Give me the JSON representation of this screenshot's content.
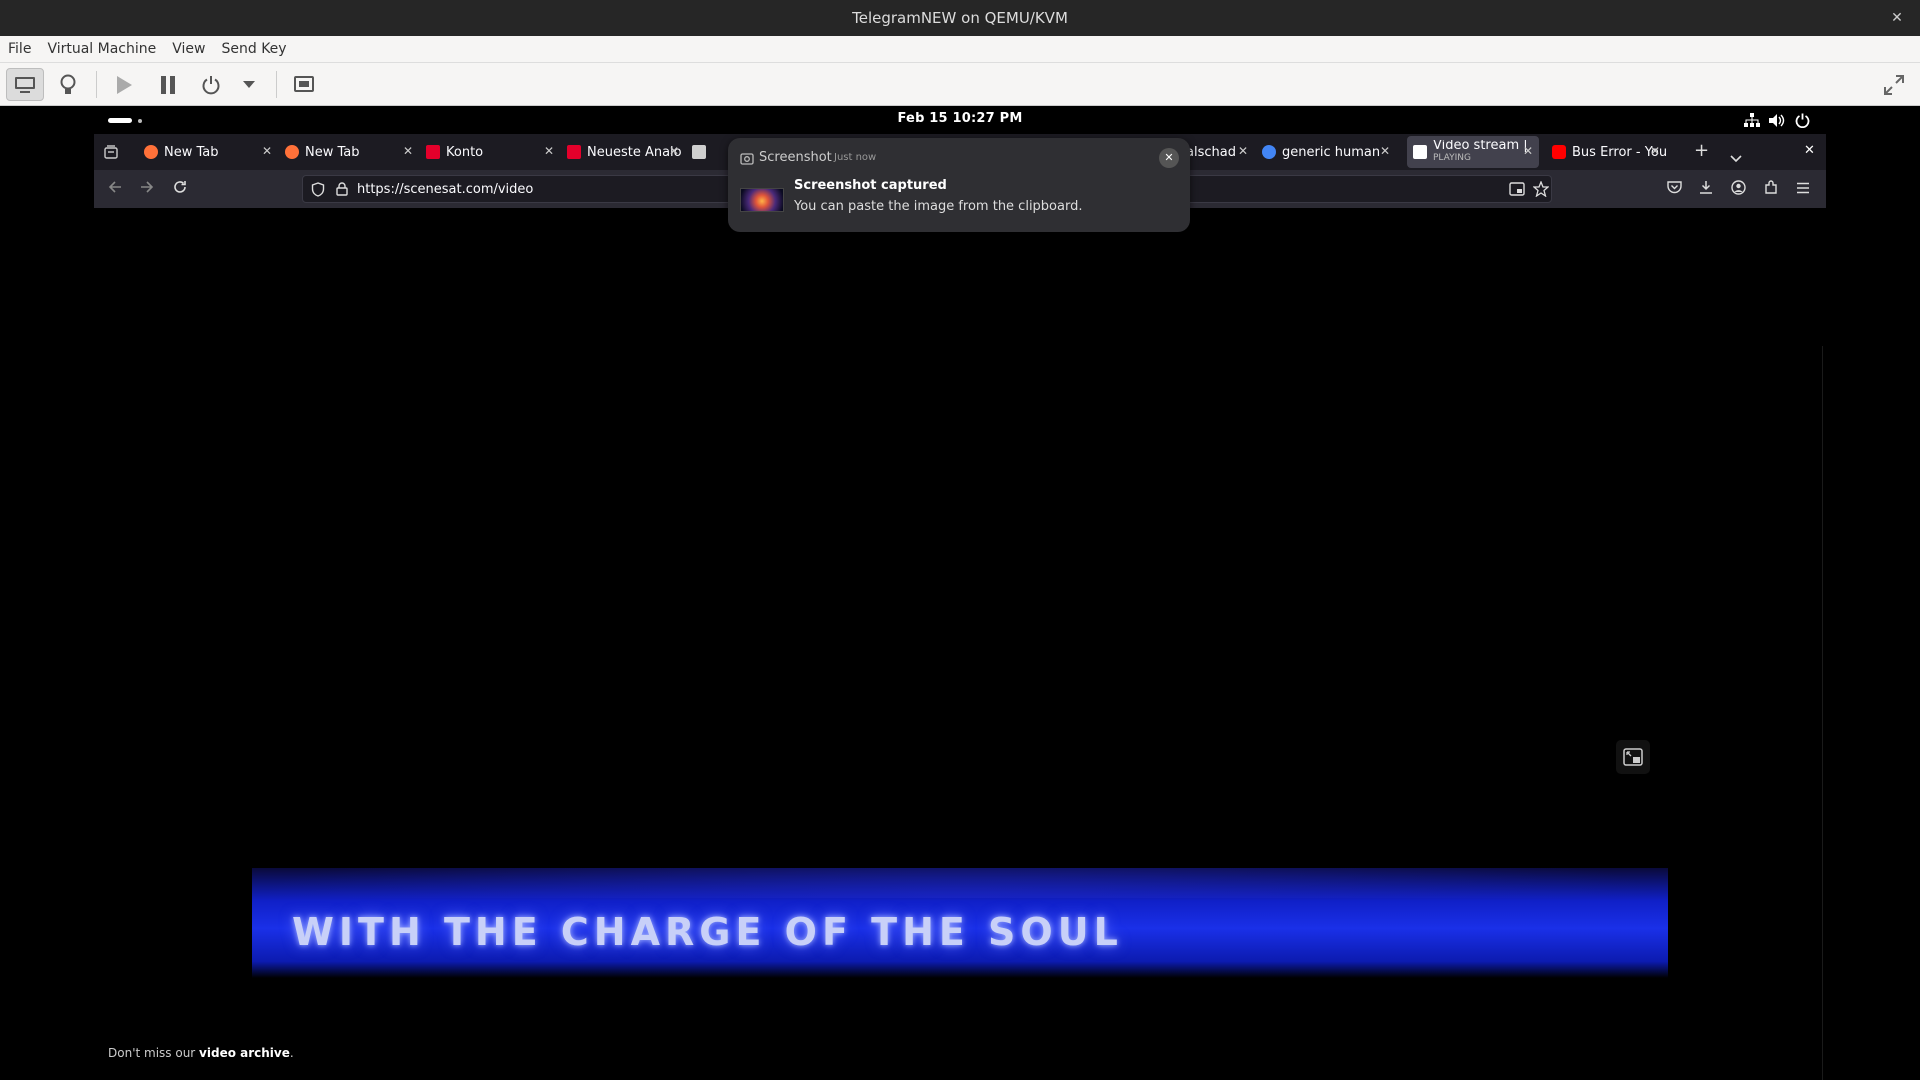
{
  "window": {
    "title": "TelegramNEW on QEMU/KVM"
  },
  "menu": {
    "items": [
      "File",
      "Virtual Machine",
      "View",
      "Send Key"
    ]
  },
  "toolbar": {
    "buttons": [
      "display-icon",
      "lightbulb-icon",
      "play-icon",
      "pause-icon",
      "power-icon",
      "dropdown-arrow-icon",
      "screenshot-icon",
      "fullscreen-icon"
    ]
  },
  "guest": {
    "clock": "Feb 15  10:27 PM",
    "browser": {
      "tabs": [
        {
          "label": "New Tab",
          "fav": "#ff7139"
        },
        {
          "label": "New Tab",
          "fav": "#ff7139"
        },
        {
          "label": "Konto",
          "fav": "#e4002b"
        },
        {
          "label": "Neueste Analo",
          "fav": "#e4002b"
        },
        {
          "label": "",
          "fav": "#cfcfcf"
        },
        {
          "label": "alschad",
          "fav": "#cfcfcf"
        },
        {
          "label": "generic human",
          "fav": "#4285f4"
        },
        {
          "label": "Video stream |",
          "sub": "PLAYING",
          "fav": "#ffffff"
        },
        {
          "label": "Bus Error - You",
          "fav": "#ff0000"
        }
      ],
      "url": "https://scenesat.com/video"
    },
    "notification": {
      "app": "Screenshot",
      "time": "Just now",
      "title": "Screenshot captured",
      "body": "You can paste the image from the clipboard."
    },
    "video": {
      "banner_text": "WITH THE CHARGE OF THE SOUL"
    },
    "footer": {
      "prefix": "Don't miss our ",
      "link": "video archive",
      "suffix": "."
    }
  }
}
